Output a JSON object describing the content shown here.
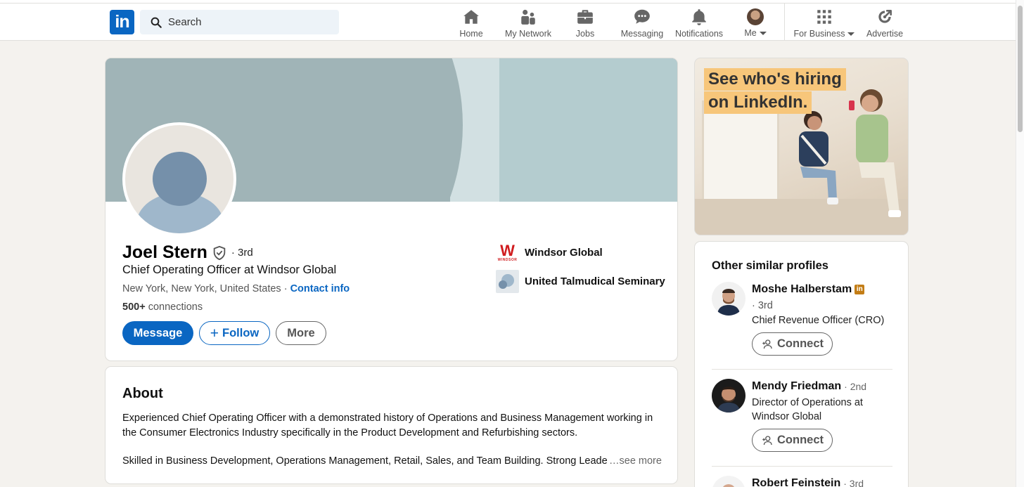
{
  "nav": {
    "logo": "in",
    "search_placeholder": "Search",
    "items": [
      {
        "label": "Home",
        "icon": "home-icon"
      },
      {
        "label": "My Network",
        "icon": "network-icon"
      },
      {
        "label": "Jobs",
        "icon": "briefcase-icon"
      },
      {
        "label": "Messaging",
        "icon": "messaging-icon"
      },
      {
        "label": "Notifications",
        "icon": "bell-icon"
      },
      {
        "label": "Me",
        "icon": "avatar"
      },
      {
        "label": "For Business",
        "icon": "grid-icon"
      },
      {
        "label": "Advertise",
        "icon": "advertise-icon"
      }
    ]
  },
  "profile": {
    "name": "Joel Stern",
    "degree": "· 3rd",
    "headline": "Chief Operating Officer at Windsor Global",
    "location": "New York, New York, United States · ",
    "contact_info": "Contact info",
    "connections_count": "500+",
    "connections_label": " connections",
    "buttons": {
      "message": "Message",
      "follow": "Follow",
      "more": "More"
    },
    "experience": [
      {
        "name": "Windsor Global",
        "logo_text": "W",
        "logo_sub": "WINDSOR"
      },
      {
        "name": "United Talmudical Seminary"
      }
    ]
  },
  "about": {
    "title": "About",
    "paragraph1": "Experienced Chief Operating Officer with a demonstrated history of Operations and Business Management working in the Consumer Electronics Industry specifically in the Product Development and Refurbishing sectors.",
    "paragraph2": "Skilled in Business Development, Operations Management, Retail, Sales, and Team Building. Strong Leade",
    "see_more": "…see more"
  },
  "ad": {
    "line1": "See who's hiring",
    "line2": "on LinkedIn."
  },
  "similar": {
    "title": "Other similar profiles",
    "people": [
      {
        "name": "Moshe Halberstam",
        "degree": "· 3rd",
        "title": "Chief Revenue Officer (CRO)",
        "connect": "Connect"
      },
      {
        "name": "Mendy Friedman",
        "degree": "· 2nd",
        "title_line1": "Director of Operations at",
        "title_line2": "Windsor Global",
        "connect": "Connect"
      },
      {
        "name": "Robert Feinstein",
        "degree": "· 3rd"
      }
    ]
  },
  "colors": {
    "brand": "#0a66c2",
    "background": "#f4f2ee"
  }
}
